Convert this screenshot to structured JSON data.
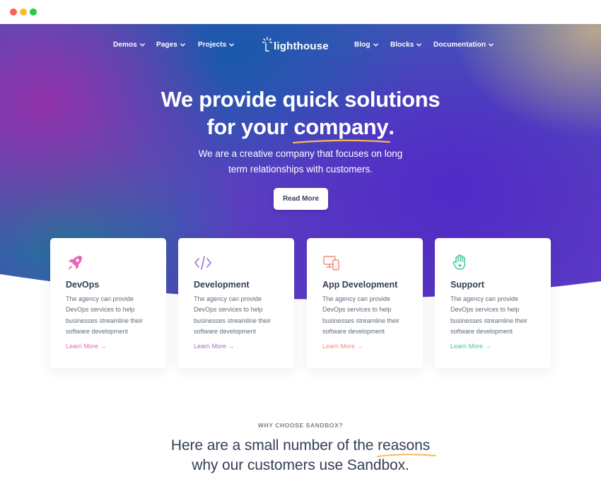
{
  "nav": {
    "left": [
      "Demos",
      "Pages",
      "Projects"
    ],
    "right": [
      "Blog",
      "Blocks",
      "Documentation"
    ],
    "logo_text": "lighthouse"
  },
  "hero": {
    "title_line1": "We provide quick solutions",
    "title_line2_prefix": "for your ",
    "title_line2_highlight": "company",
    "title_line2_suffix": ".",
    "subtitle_line1": "We are a creative company that focuses on long",
    "subtitle_line2": "term relationships with customers.",
    "button_label": "Read More"
  },
  "cards": [
    {
      "title": "DevOps",
      "icon": "rocket-icon",
      "color": "#e668b3",
      "text": "The agency can provide DevOps services to help businesses streamline their software development",
      "link": "Learn More →"
    },
    {
      "title": "Development",
      "icon": "code-icon",
      "color": "#9d6fc7",
      "text": "The agency can provide DevOps services to help businesses streamline their software development",
      "link": "Learn More →"
    },
    {
      "title": "App Development",
      "icon": "devices-icon",
      "color": "#f78b77",
      "text": "The agency can provide DevOps services to help businesses streamline their software development",
      "link": "Learn More →"
    },
    {
      "title": "Support",
      "icon": "hand-icon",
      "color": "#45c4a0",
      "text": "The agency can provide DevOps services to help businesses streamline their software development",
      "link": "Learn More →"
    }
  ],
  "why": {
    "eyebrow": "WHY CHOOSE SANDBOX?",
    "title_line1_prefix": "Here are a small number of the ",
    "title_line1_highlight": "reasons",
    "title_line2": "why our customers use Sandbox."
  },
  "colors": {
    "accent_underline": "#fab758",
    "text_dark": "#343f52"
  }
}
